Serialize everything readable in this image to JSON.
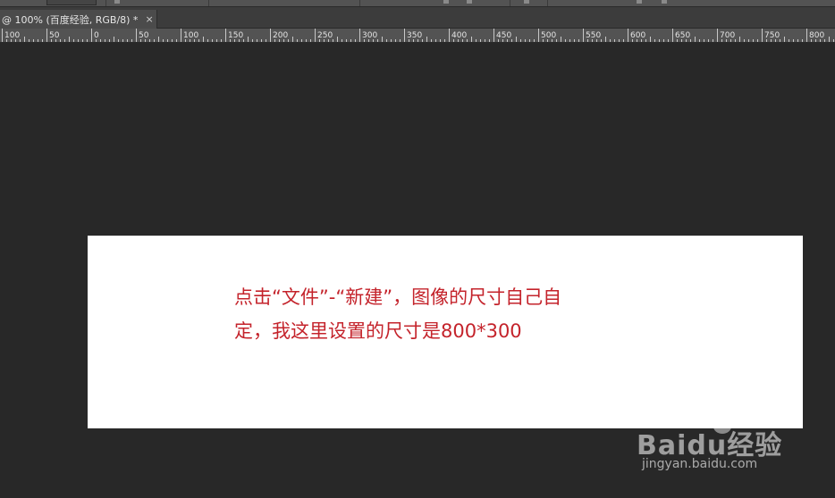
{
  "document_tab": {
    "title": "@ 100% (百度经验, RGB/8) *",
    "close_glyph": "×"
  },
  "ruler": {
    "labels": [
      "100",
      "50",
      "0",
      "50",
      "100",
      "150",
      "200",
      "250",
      "300",
      "350",
      "400",
      "450",
      "500",
      "550",
      "600",
      "650",
      "700",
      "750",
      "800"
    ]
  },
  "annotation": {
    "line1": "点击“文件”-“新建”，图像的尺寸自己自",
    "line2": "定，我这里设置的尺寸是800*300"
  },
  "watermark": {
    "brand": "Baidu经验",
    "url": "jingyan.baidu.com"
  },
  "colors": {
    "annotation_text": "#c4232b",
    "workspace": "#282828",
    "canvas": "#ffffff",
    "ruler": "#535353"
  }
}
